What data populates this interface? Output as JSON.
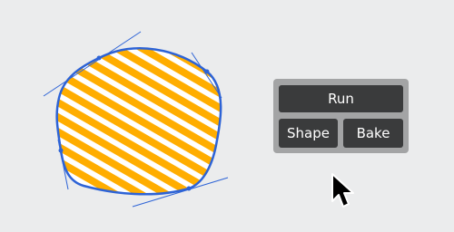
{
  "toolbar": {
    "run_label": "Run",
    "shape_label": "Shape",
    "bake_label": "Bake"
  },
  "colors": {
    "background": "#ebeced",
    "stripe_fill": "#ffad00",
    "stripe_gap": "#ffffff",
    "outline": "#2d63d6",
    "panel": "#a3a4a5",
    "button": "#3a3b3c",
    "button_text": "#ffffff",
    "cursor": "#000000"
  },
  "icons": {
    "cursor": "arrow-cursor-icon"
  }
}
